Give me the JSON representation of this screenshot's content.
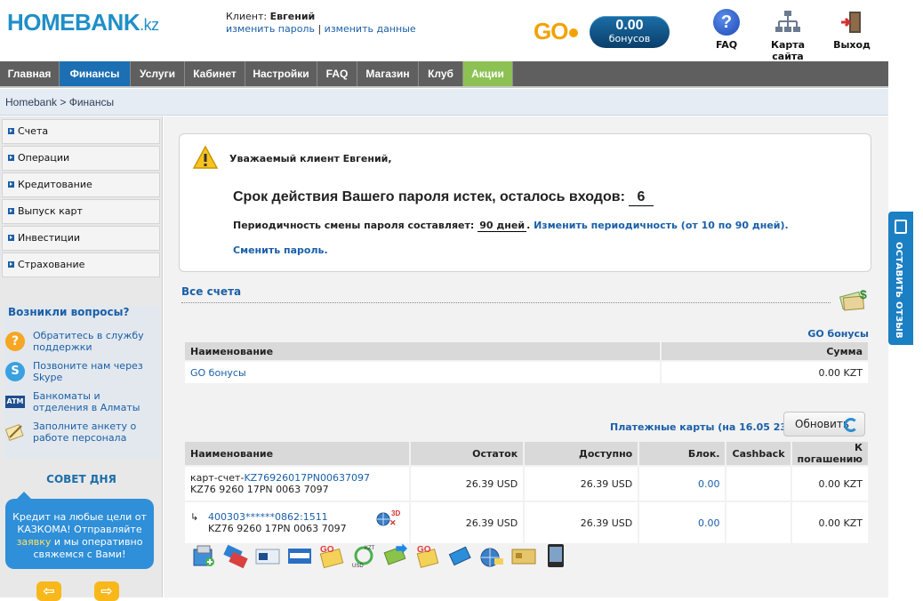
{
  "header": {
    "logo_main": "HOMEBANK",
    "logo_suffix": ".kz",
    "client_label": "Клиент:",
    "client_name": "Евгений",
    "change_password": "изменить пароль",
    "separator": "|",
    "change_data": "изменить данные",
    "go_logo": "GO",
    "bonus_value": "0.00",
    "bonus_label": "бонусов",
    "faq_label": "FAQ",
    "sitemap_label": "Карта сайта",
    "logout_label": "Выход",
    "faq_icon_glyph": "?"
  },
  "nav": {
    "items": [
      {
        "label": "Главная"
      },
      {
        "label": "Финансы"
      },
      {
        "label": "Услуги"
      },
      {
        "label": "Кабинет"
      },
      {
        "label": "Настройки"
      },
      {
        "label": "FAQ"
      },
      {
        "label": "Магазин"
      },
      {
        "label": "Клуб"
      },
      {
        "label": "Акции"
      }
    ],
    "active": "Финансы"
  },
  "breadcrumb": "Homebank > Финансы",
  "sidebar": {
    "items": [
      {
        "label": "Счета"
      },
      {
        "label": "Операции"
      },
      {
        "label": "Кредитование"
      },
      {
        "label": "Выпуск карт"
      },
      {
        "label": "Инвестиции"
      },
      {
        "label": "Страхование"
      }
    ],
    "questions_title": "Возникли вопросы?",
    "questions": [
      {
        "text": "Обратитесь в службу поддержки",
        "icon": "help-icon"
      },
      {
        "text": "Позвоните нам через Skype",
        "icon": "skype-icon"
      },
      {
        "text": "Банкоматы и отделения в Алматы",
        "icon": "atm-icon"
      },
      {
        "text": "Заполните анкету о работе персонала",
        "icon": "form-icon"
      }
    ],
    "tip_title": "СОВЕТ ДНЯ",
    "tip_text_1": "Кредит на любые цели от КАЗКОМА! Отправляйте",
    "tip_link": "заявку",
    "tip_text_2": "и мы оперативно свяжемся с Вами!",
    "prev_arrow": "⇦",
    "next_arrow": "⇨"
  },
  "alert": {
    "greeting": "Уважаемый клиент Евгений,",
    "main_text": "Срок действия Вашего пароля истек, осталось входов:",
    "logins_left": "6",
    "period_label": "Периодичность смены пароля составляет:",
    "period_days": "90 дней",
    "period_end": ".",
    "change_period_link": "Изменить периодичность (от 10 по 90 дней).",
    "change_password_link": "Сменить пароль."
  },
  "accounts": {
    "title": "Все счета",
    "go_bonus_link": "GO бонусы",
    "bonus_table": {
      "headers": [
        "Наименование",
        "Сумма"
      ],
      "rows": [
        {
          "name": "GO бонусы",
          "sum": "0.00 KZT"
        }
      ]
    }
  },
  "cards": {
    "title": "Платежные карты (на 16.05 23:02)",
    "refresh_label": "Обновить",
    "headers": [
      "Наименование",
      "Остаток",
      "Доступно",
      "Блок.",
      "Cashback",
      "К погашению"
    ],
    "rows": [
      {
        "prefix": "карт-счет-",
        "account_link": "KZ76926017PN00637097",
        "sub": "KZ76 9260 17PN 0063 7097",
        "balance": "26.39 USD",
        "available": "26.39 USD",
        "blocked": "0.00",
        "cashback": "",
        "repay": "0.00 KZT"
      },
      {
        "prefix": "",
        "account_link": "400303******0862:1511",
        "sub": "KZ76 9260 17PN 0063 7097",
        "balance": "26.39 USD",
        "available": "26.39 USD",
        "blocked": "0.00",
        "cashback": "",
        "repay": "0.00 KZT"
      }
    ]
  },
  "feedback": "ОСТАВИТЬ ОТЗЫВ",
  "colors": {
    "nav_active": "#1b6fb2",
    "nav_promo": "#8dc154",
    "link": "#1a5fa8",
    "bonus_pill": "#0a3f6b"
  }
}
